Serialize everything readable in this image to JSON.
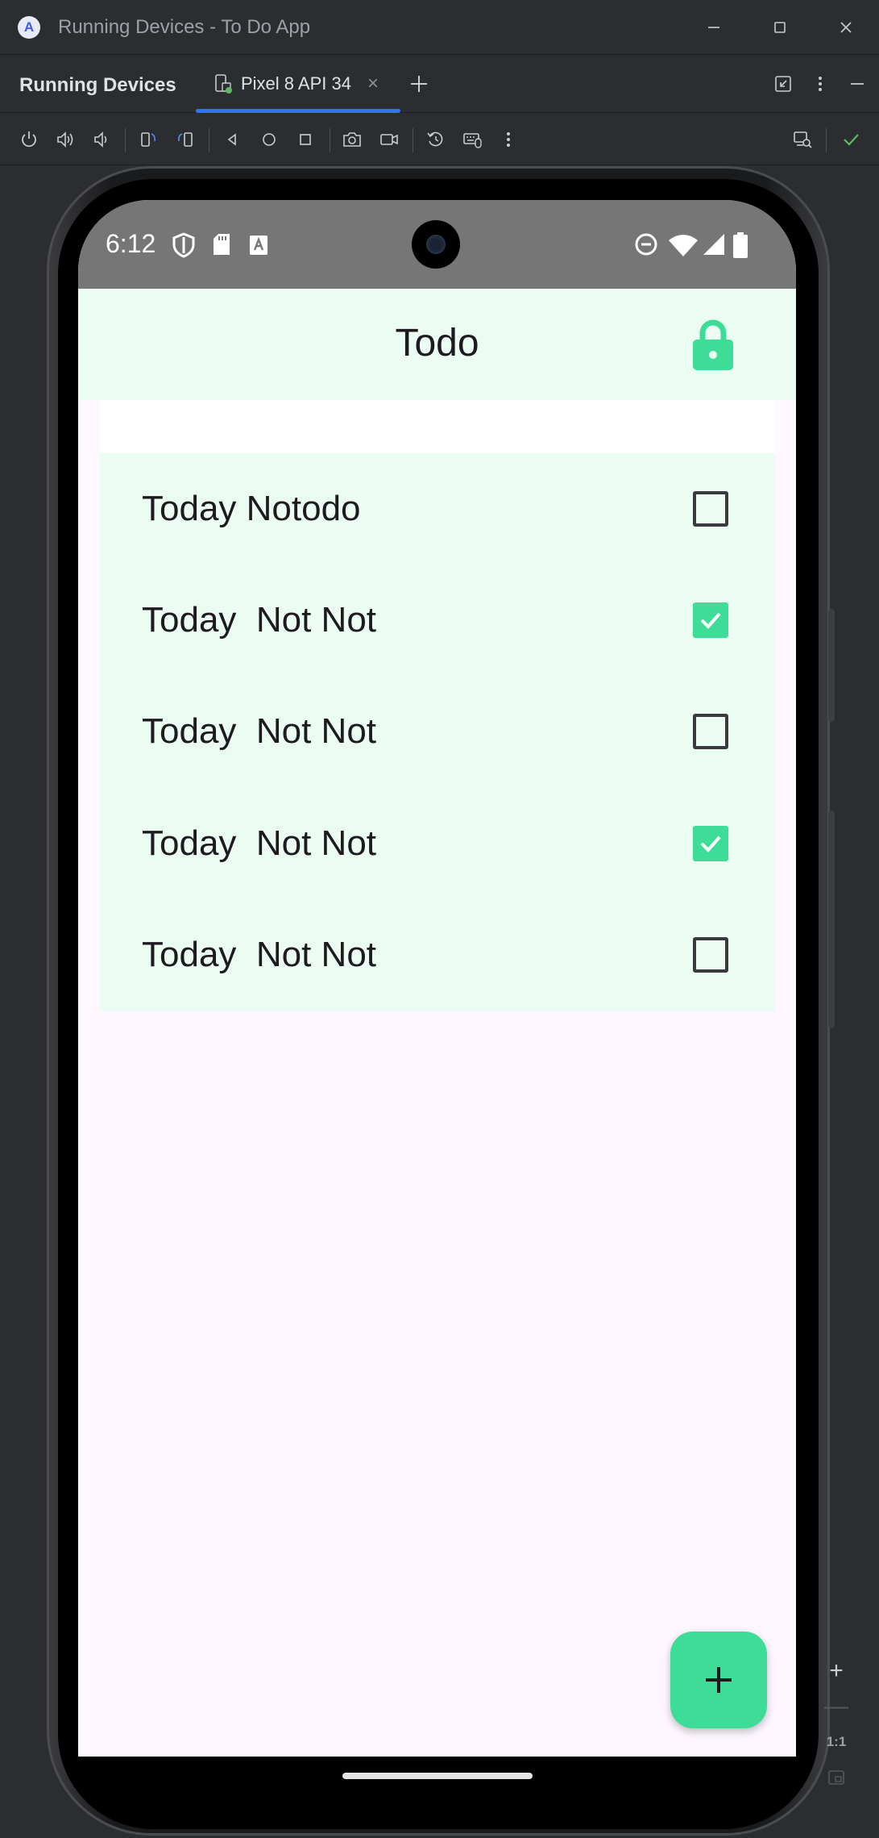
{
  "window": {
    "title": "Running Devices - To Do App",
    "logo_glyph": "A"
  },
  "tool_window": {
    "title": "Running Devices",
    "tab_label": "Pixel 8 API 34",
    "tab_close": "×",
    "add_tab": "+"
  },
  "zoom": {
    "plus": "+",
    "minus": "—",
    "actual_size": "1:1"
  },
  "phone": {
    "status_bar": {
      "time": "6:12"
    },
    "app_bar": {
      "title": "Todo"
    },
    "todos": [
      {
        "text": "Today Notodo",
        "checked": false
      },
      {
        "text": "Today  Not Not",
        "checked": true
      },
      {
        "text": "Today  Not Not",
        "checked": false
      },
      {
        "text": "Today  Not Not",
        "checked": true
      },
      {
        "text": "Today  Not Not",
        "checked": false
      }
    ]
  },
  "colors": {
    "accent_green": "#3ddc97",
    "list_background": "#ebfcf2",
    "ide_background": "#2b2d30",
    "tab_underline": "#3574f0",
    "status_bar": "#767676"
  },
  "icons": [
    "android-studio-icon",
    "minimize-icon",
    "maximize-icon",
    "close-icon",
    "device-tab-icon",
    "add-icon",
    "collapse-icon",
    "more-vert-icon",
    "hide-icon",
    "power-icon",
    "volume-up-icon",
    "volume-down-icon",
    "rotate-left-icon",
    "rotate-right-icon",
    "back-icon",
    "home-icon",
    "overview-icon",
    "screenshot-icon",
    "screen-record-icon",
    "snapshot-icon",
    "keyboard-mouse-icon",
    "mirror-settings-icon",
    "check-icon",
    "shield-icon",
    "sd-card-icon",
    "a-box-icon",
    "dnd-icon",
    "wifi-icon",
    "signal-icon",
    "battery-icon",
    "lock-icon",
    "plus-icon"
  ]
}
